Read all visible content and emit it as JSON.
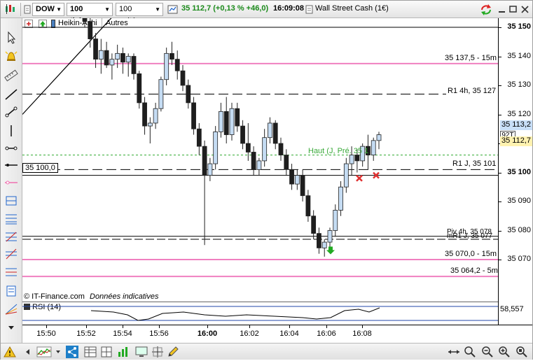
{
  "toolbar": {
    "symbol": "DOW",
    "ticks": "100 ticks",
    "units": "100 unités",
    "quote": "35 112,7 (+0,13 % +46,0)",
    "time": "16:09:08",
    "instrument": "Wall Street Cash (1€)"
  },
  "toolbar2": {
    "chart_style": "Heikin-Ashi",
    "others": "Autres"
  },
  "watermark": {
    "source": "© IT-Finance.com",
    "note": "Données indicatives"
  },
  "rsi": {
    "label": "RSI (14)",
    "value": "58,557"
  },
  "price_axis": {
    "ticks": [
      "35 150",
      "35 140",
      "35 130",
      "35 120",
      "35 110",
      "35 100",
      "35 090",
      "35 080",
      "35 070"
    ],
    "current_price": "35 113,2",
    "last_price": "35 112,7",
    "tag": "92T",
    "colors": {
      "current": "#c8dff8",
      "last": "#fff2b0"
    }
  },
  "time_axis": {
    "labels": [
      "15:50",
      "15:52",
      "15:54",
      "15:56",
      "16:00",
      "16:02",
      "16:04",
      "16:06",
      "16:08"
    ]
  },
  "levels": {
    "l_137": "35 137,5 - 15m",
    "r1_4h": "R1 4h, 35 127",
    "haut": "Haut (J, Pré. 35 1",
    "r1_j": "R1 J, 35 101",
    "left_box": "35 100,0",
    "piv": "Piv 4h, 35 078",
    "mr1": "mR1 J, 35 077",
    "l_070": "35 070,0 - 15m",
    "l_064": "35 064,2 - 5m"
  },
  "colors": {
    "candle_up": "#c5dcf3",
    "candle_down": "#1e1e1e",
    "pink_level": "#f080c0",
    "green_line": "#2eaa2e",
    "marker_red": "#e03030",
    "marker_green": "#22aa22"
  },
  "chart_data": {
    "type": "candlestick",
    "ylim": [
      35065,
      35152
    ],
    "x_time_labels": [
      "15:50",
      "15:52",
      "15:54",
      "15:56",
      "16:00",
      "16:02",
      "16:04",
      "16:06",
      "16:08"
    ],
    "candles": [
      [
        35154,
        35156,
        35150,
        35152
      ],
      [
        35152,
        35154,
        35143,
        35146
      ],
      [
        35146,
        35148,
        35136,
        35139
      ],
      [
        35139,
        35146,
        35134,
        35142
      ],
      [
        35142,
        35145,
        35136,
        35137
      ],
      [
        35137,
        35141,
        35132,
        35139
      ],
      [
        35139,
        35144,
        35136,
        35141
      ],
      [
        35141,
        35143,
        35134,
        35138
      ],
      [
        35138,
        35141,
        35133,
        35140
      ],
      [
        35140,
        35141,
        35132,
        35134
      ],
      [
        35134,
        35135,
        35122,
        35124
      ],
      [
        35124,
        35126,
        35113,
        35116
      ],
      [
        35116,
        35119,
        35110,
        35117
      ],
      [
        35117,
        35124,
        35115,
        35122
      ],
      [
        35122,
        35133,
        35121,
        35132
      ],
      [
        35132,
        35143,
        35130,
        35141
      ],
      [
        35141,
        35145,
        35137,
        35139
      ],
      [
        35139,
        35142,
        35132,
        35135
      ],
      [
        35135,
        35137,
        35128,
        35130
      ],
      [
        35130,
        35132,
        35122,
        35124
      ],
      [
        35124,
        35126,
        35113,
        35115
      ],
      [
        35115,
        35117,
        35106,
        35109
      ],
      [
        35109,
        35111,
        35075,
        35099
      ],
      [
        35099,
        35105,
        35097,
        35103
      ],
      [
        35103,
        35116,
        35101,
        35114
      ],
      [
        35114,
        35124,
        35112,
        35121
      ],
      [
        35121,
        35126,
        35110,
        35113
      ],
      [
        35113,
        35124,
        35111,
        35122
      ],
      [
        35122,
        35124,
        35114,
        35116
      ],
      [
        35116,
        35118,
        35108,
        35110
      ],
      [
        35110,
        35117,
        35104,
        35107
      ],
      [
        35107,
        35109,
        35099,
        35101
      ],
      [
        35101,
        35105,
        35099,
        35104
      ],
      [
        35104,
        35115,
        35102,
        35112
      ],
      [
        35112,
        35119,
        35110,
        35117
      ],
      [
        35117,
        35118,
        35108,
        35110
      ],
      [
        35110,
        35112,
        35104,
        35106
      ],
      [
        35106,
        35108,
        35099,
        35101
      ],
      [
        35101,
        35103,
        35094,
        35096
      ],
      [
        35096,
        35101,
        35094,
        35099
      ],
      [
        35099,
        35101,
        35090,
        35092
      ],
      [
        35092,
        35094,
        35083,
        35085
      ],
      [
        35085,
        35087,
        35077,
        35079
      ],
      [
        35079,
        35081,
        35072,
        35074
      ],
      [
        35074,
        35077,
        35071,
        35076
      ],
      [
        35076,
        35081,
        35074,
        35080
      ],
      [
        35080,
        35089,
        35078,
        35087
      ],
      [
        35087,
        35097,
        35085,
        35095
      ],
      [
        35095,
        35105,
        35093,
        35103
      ],
      [
        35103,
        35109,
        35099,
        35106
      ],
      [
        35106,
        35108,
        35100,
        35104
      ],
      [
        35104,
        35110,
        35102,
        35109
      ],
      [
        35109,
        35113,
        35101,
        35106
      ],
      [
        35106,
        35112,
        35104,
        35111
      ],
      [
        35111,
        35114,
        35108,
        35113
      ]
    ],
    "levels": [
      35137.5,
      35127,
      35106,
      35101,
      35078,
      35077,
      35070,
      35064.2
    ]
  }
}
